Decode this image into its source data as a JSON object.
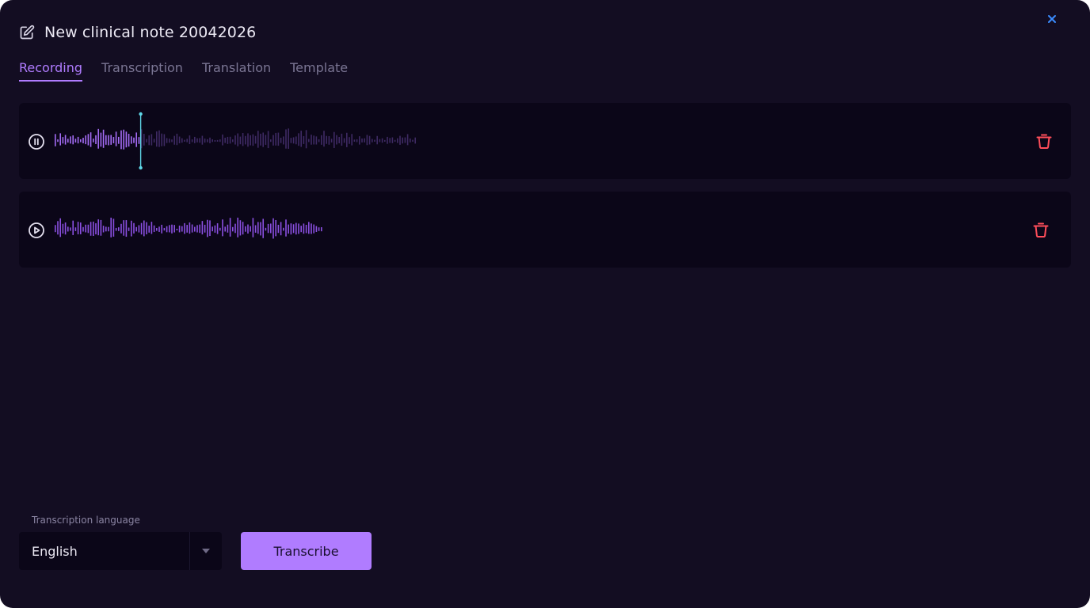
{
  "dialog": {
    "title": "New clinical note 20042026",
    "close_icon": "close-icon",
    "edit_icon": "edit-icon"
  },
  "tabs": [
    {
      "label": "Recording",
      "active": true
    },
    {
      "label": "Transcription",
      "active": false
    },
    {
      "label": "Translation",
      "active": false
    },
    {
      "label": "Template",
      "active": false
    }
  ],
  "recordings": [
    {
      "state": "playing",
      "control_icon": "pause-icon",
      "delete_icon": "trash-icon",
      "progress": 0.24
    },
    {
      "state": "paused",
      "control_icon": "play-icon",
      "delete_icon": "trash-icon",
      "progress": 0
    }
  ],
  "language": {
    "label": "Transcription language",
    "value": "English",
    "arrow_icon": "caret-down-icon"
  },
  "actions": {
    "transcribe_label": "Transcribe"
  },
  "colors": {
    "accent": "#b07cff",
    "wave_played": "#a46cf5",
    "wave_unplayed": "#3e2a63",
    "wave_second": "#8a4fe0",
    "playhead": "#5fd8e8",
    "danger": "#ff4d5a",
    "close": "#3b8cff",
    "background": "#130d22",
    "panel": "#0b0618"
  }
}
